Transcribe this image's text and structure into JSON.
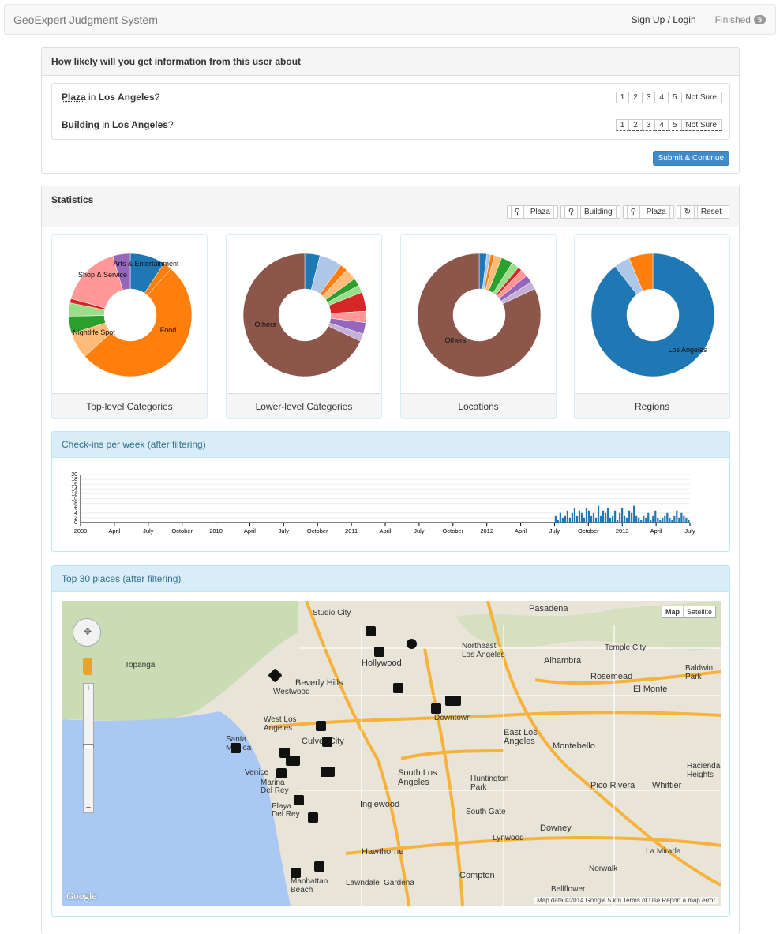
{
  "nav": {
    "brand": "GeoExpert Judgment System",
    "login": "Sign Up / Login",
    "finished": "Finished",
    "finished_count": "5"
  },
  "question": {
    "heading": "How likely will you get information from this user about",
    "rows": [
      {
        "category": "Plaza",
        "in": "in",
        "location": "Los Angeles",
        "q": "?"
      },
      {
        "category": "Building",
        "in": "in",
        "location": "Los Angeles",
        "q": "?"
      }
    ],
    "options": [
      "1",
      "2",
      "3",
      "4",
      "5",
      "Not Sure"
    ],
    "submit": "Submit & Continue"
  },
  "stats": {
    "heading": "Statistics",
    "filters": [
      "Plaza",
      "Building",
      "Plaza"
    ],
    "reset": "Reset",
    "pies": [
      {
        "caption": "Top-level Categories",
        "labels": [
          "Arts & Entertainment",
          "Shop & Service",
          "Food",
          "Nightlife Spot"
        ]
      },
      {
        "caption": "Lower-level Categories",
        "labels": [
          "Others"
        ]
      },
      {
        "caption": "Locations",
        "labels": [
          "Others"
        ]
      },
      {
        "caption": "Regions",
        "labels": [
          "Los Angeles"
        ]
      }
    ]
  },
  "colors": [
    "#1f77b4",
    "#aec7e8",
    "#ff7f0e",
    "#ffbb78",
    "#2ca02c",
    "#98df8a",
    "#d62728",
    "#ff9896",
    "#9467bd",
    "#c5b0d5",
    "#8c564b"
  ],
  "checkins": {
    "heading": "Check-ins per week (after filtering)",
    "y_ticks": [
      "20",
      "18",
      "16",
      "14",
      "12",
      "10",
      "8",
      "6",
      "4",
      "2",
      "0"
    ],
    "x_ticks": [
      "2009",
      "April",
      "July",
      "October",
      "2010",
      "April",
      "July",
      "October",
      "2011",
      "April",
      "July",
      "October",
      "2012",
      "April",
      "July",
      "October",
      "2013",
      "April",
      "July"
    ]
  },
  "chart_data": {
    "type": "bar",
    "title": "Check-ins per week (after filtering)",
    "xlabel": "",
    "ylabel": "",
    "ylim": [
      0,
      20
    ],
    "x_range": [
      "2009-01",
      "2013-07"
    ],
    "grid": true,
    "weeks_start": "2012-07",
    "values": [
      3,
      1,
      4,
      2,
      3,
      5,
      2,
      4,
      6,
      3,
      5,
      4,
      2,
      6,
      5,
      3,
      4,
      2,
      7,
      3,
      5,
      4,
      6,
      2,
      3,
      5,
      1,
      4,
      6,
      3,
      2,
      5,
      4,
      7,
      3,
      2,
      1,
      3,
      2,
      4,
      1,
      3,
      5,
      2,
      1,
      2,
      3,
      4,
      2,
      1,
      3,
      5,
      2,
      4,
      3,
      2,
      1
    ]
  },
  "map": {
    "heading": "Top 30 places (after filtering)",
    "type_map": "Map",
    "type_sat": "Satellite",
    "footer": "Map data ©2014 Google   5 km   Terms of Use   Report a map error",
    "logo": "Google",
    "labels": [
      "Pasadena",
      "Studio City",
      "Hollywood",
      "Beverly Hills",
      "Northeast Los Angeles",
      "Alhambra",
      "Rosemead",
      "El Monte",
      "Santa Monica",
      "Culver City",
      "Downtown",
      "East Los Angeles",
      "Montebello",
      "Inglewood",
      "South Los Angeles",
      "Huntington Park",
      "Pico Rivera",
      "Whittier",
      "South Gate",
      "Downey",
      "Hawthorne",
      "Compton",
      "Norwalk",
      "Bellflower",
      "Lawndale",
      "Gardena",
      "Lynwood",
      "Manhattan Beach",
      "Topanga",
      "Temple City",
      "Baldwin Park",
      "Hacienda Heights",
      "La Mirada",
      "Marina Del Rey",
      "Playa Del Rey",
      "Westwood",
      "West Los Angeles",
      "Venice"
    ]
  }
}
